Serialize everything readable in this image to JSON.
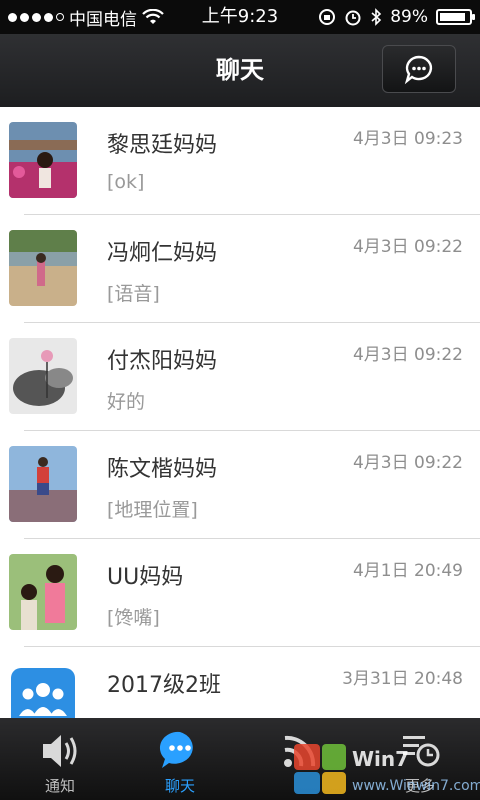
{
  "status_bar": {
    "carrier": "中国电信",
    "time": "上午9:23",
    "battery": "89%",
    "battery_level": 0.89
  },
  "nav": {
    "title": "聊天",
    "compose_icon": "chat-bubble-icon"
  },
  "chats": [
    {
      "name": "黎思廷妈妈",
      "time": "4月3日 09:23",
      "preview": "[ok]"
    },
    {
      "name": "冯炯仁妈妈",
      "time": "4月3日 09:22",
      "preview": "[语音]"
    },
    {
      "name": "付杰阳妈妈",
      "time": "4月3日 09:22",
      "preview": "好的"
    },
    {
      "name": "陈文楷妈妈",
      "time": "4月3日 09:22",
      "preview": "[地理位置]"
    },
    {
      "name": "UU妈妈",
      "time": "4月1日 20:49",
      "preview": "[馋嘴]"
    },
    {
      "name": "2017级2班",
      "time": "3月31日 20:48",
      "preview": ""
    }
  ],
  "tabs": [
    {
      "label": "通知",
      "icon": "speaker-icon"
    },
    {
      "label": "聊天",
      "icon": "chat-icon",
      "active": true
    },
    {
      "label": "",
      "icon": "feed-icon"
    },
    {
      "label": "更多",
      "icon": "more-icon"
    }
  ],
  "colors": {
    "accent": "#2aa0ff",
    "nav_bg": "#262729",
    "group_avatar": "#2d8fe3"
  }
}
